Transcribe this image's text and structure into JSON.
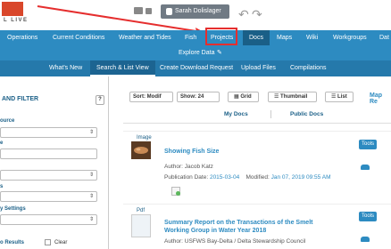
{
  "logo_text": "L LIVE",
  "user": {
    "name": "Sarah Dolislager"
  },
  "nav": {
    "operations": "Operations",
    "current_conditions": "Current Conditions",
    "weather_tides": "Weather and Tides",
    "fish": "Fish",
    "projects": "Projects",
    "docs": "Docs",
    "maps": "Maps",
    "wiki": "Wiki",
    "workgroups": "Workgroups",
    "data": "Dat"
  },
  "subbar": {
    "explore_data": "Explore Data"
  },
  "subnav": {
    "whats_new": "What's New",
    "search_list_view": "Search & List View",
    "create_download_request": "Create Download Request",
    "upload_files": "Upload Files",
    "compilations": "Compilations"
  },
  "left_panel": {
    "title": "AND FILTER",
    "help": "?",
    "source_label": "ource",
    "label_e": "e",
    "label_s": "s",
    "settings_label": "y Settings",
    "results_label": "o Results",
    "clear_label": "Clear"
  },
  "controls": {
    "sort": "Sort: Modif",
    "show": "Show: 24",
    "grid": "Grid",
    "thumbnail": "Thumbnail",
    "list": "List",
    "map": "Map Re"
  },
  "tabs": {
    "my_docs": "My Docs",
    "public_docs": "Public Docs"
  },
  "documents": [
    {
      "type": "Image",
      "title": "Showing Fish Size",
      "author": "Author: Jacob Katz",
      "pub_label": "Publication Date:",
      "pub_date": "2015-03-04",
      "mod_label": "Modified:",
      "mod_date": "Jan 07, 2019 09:55 AM",
      "tools": "Tools"
    },
    {
      "type": "Pdf",
      "title": "Summary Report on the Transactions of the Smelt Working Group in Water Year 2018",
      "author": "Author: USFWS Bay-Delta / Delta Stewardship Council",
      "tools": "Tools"
    }
  ]
}
